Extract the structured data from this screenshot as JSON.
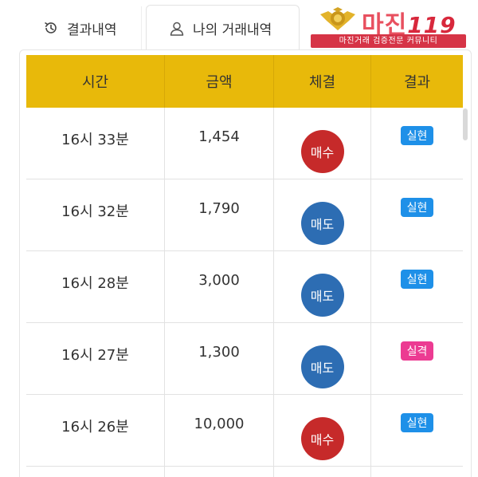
{
  "tabs": [
    {
      "label": "결과내역",
      "icon": "history-icon"
    },
    {
      "label": "나의 거래내역",
      "icon": "user-icon"
    }
  ],
  "logo": {
    "brand": "마진",
    "number": "119",
    "tagline": "마진거래 검증전문 커뮤니티"
  },
  "table": {
    "headers": [
      "시간",
      "금액",
      "체결",
      "결과"
    ],
    "rows": [
      {
        "time": "16시 33분",
        "amount": "1,454",
        "trade": "매수",
        "result": "실현"
      },
      {
        "time": "16시 32분",
        "amount": "1,790",
        "trade": "매도",
        "result": "실현"
      },
      {
        "time": "16시 28분",
        "amount": "3,000",
        "trade": "매도",
        "result": "실현"
      },
      {
        "time": "16시 27분",
        "amount": "1,300",
        "trade": "매도",
        "result": "실격"
      },
      {
        "time": "16시 26분",
        "amount": "10,000",
        "trade": "매수",
        "result": "실현"
      }
    ]
  },
  "colors": {
    "header": "#e8b90a",
    "buy": "#c62a2a",
    "sell": "#2d6db3",
    "realized": "#1e90e8",
    "failed": "#ec3b92"
  }
}
